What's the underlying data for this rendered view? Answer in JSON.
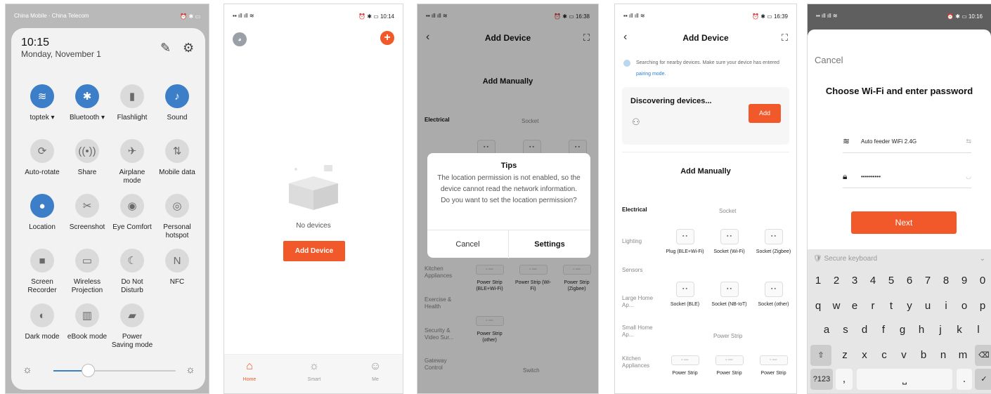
{
  "screen1": {
    "status_left": "China Mobile · China Telecom",
    "status_right": "⏰ ✱ ▭",
    "time": "10:15",
    "date": "Monday, November 1",
    "tiles": [
      {
        "label": "toptek ▾",
        "icon": "wifi-icon",
        "glyph": "≋",
        "on": true
      },
      {
        "label": "Bluetooth ▾",
        "icon": "bluetooth-icon",
        "glyph": "✱",
        "on": true
      },
      {
        "label": "Flashlight",
        "icon": "flashlight-icon",
        "glyph": "▮",
        "on": false
      },
      {
        "label": "Sound",
        "icon": "bell-icon",
        "glyph": "♪",
        "on": true
      },
      {
        "label": "Auto-rotate",
        "icon": "rotate-icon",
        "glyph": "⟳",
        "on": false
      },
      {
        "label": "Share",
        "icon": "share-icon",
        "glyph": "((•))",
        "on": false
      },
      {
        "label": "Airplane mode",
        "icon": "airplane-icon",
        "glyph": "✈",
        "on": false
      },
      {
        "label": "Mobile data",
        "icon": "mobile-data-icon",
        "glyph": "⇅",
        "on": false
      },
      {
        "label": "Location",
        "icon": "location-icon",
        "glyph": "●",
        "on": true
      },
      {
        "label": "Screenshot",
        "icon": "screenshot-icon",
        "glyph": "✂",
        "on": false
      },
      {
        "label": "Eye Comfort",
        "icon": "eye-icon",
        "glyph": "◉",
        "on": false
      },
      {
        "label": "Personal hotspot",
        "icon": "hotspot-icon",
        "glyph": "◎",
        "on": false
      },
      {
        "label": "Screen Recorder",
        "icon": "recorder-icon",
        "glyph": "■",
        "on": false
      },
      {
        "label": "Wireless Projection",
        "icon": "projection-icon",
        "glyph": "▭",
        "on": false
      },
      {
        "label": "Do Not Disturb",
        "icon": "moon-icon",
        "glyph": "☾",
        "on": false
      },
      {
        "label": "NFC",
        "icon": "nfc-icon",
        "glyph": "N",
        "on": false
      },
      {
        "label": "Dark mode",
        "icon": "dark-mode-icon",
        "glyph": "◐",
        "on": false
      },
      {
        "label": "eBook mode",
        "icon": "book-icon",
        "glyph": "▥",
        "on": false
      },
      {
        "label": "Power Saving mode",
        "icon": "battery-icon",
        "glyph": "▰",
        "on": false
      }
    ],
    "brightness": 0.28
  },
  "screen2": {
    "status_left": "▪▪ ıll ıll ≋",
    "status_right": "⏰ ✱ ▭ 10:14",
    "empty_text": "No devices",
    "add_button": "Add Device",
    "tabs": [
      "Home",
      "Smart",
      "Me"
    ]
  },
  "screen3": {
    "status_left": "▪▪ ıll ıll ≋",
    "status_right": "⏰ ✱ ▭ 16:38",
    "title": "Add Device",
    "section": "Add Manually",
    "categories": [
      "Electrical",
      "Kitchen Appliances",
      "Exercise & Health",
      "Security & Video Sur...",
      "Gateway Control"
    ],
    "group_socket": "Socket",
    "group_switch": "Switch",
    "strips": [
      "Power Strip (BLE+Wi-Fi)",
      "Power Strip (Wi-Fi)",
      "Power Strip (Zigbee)",
      "Power Strip (other)"
    ],
    "dialog": {
      "title": "Tips",
      "message": "The location permission is not enabled, so the device cannot read the network information. Do you want to set the location permission?",
      "cancel": "Cancel",
      "settings": "Settings"
    }
  },
  "screen4": {
    "status_left": "▪▪ ıll ıll ≋",
    "status_right": "⏰ ✱ ▭ 16:39",
    "title": "Add Device",
    "search_text": "Searching for nearby devices. Make sure your device has entered",
    "search_link": "pairing mode.",
    "discovering": "Discovering devices...",
    "add_button": "Add",
    "section": "Add Manually",
    "categories": [
      "Electrical",
      "Lighting",
      "Sensors",
      "Large Home Ap...",
      "Small Home Ap...",
      "Kitchen Appliances"
    ],
    "group_socket": "Socket",
    "group_strip": "Power Strip",
    "sockets": [
      "Plug (BLE+Wi-Fi)",
      "Socket (Wi-Fi)",
      "Socket (Zigbee)",
      "Socket (BLE)",
      "Socket (NB-IoT)",
      "Socket (other)"
    ],
    "strips": [
      "Power Strip",
      "Power Strip",
      "Power Strip"
    ]
  },
  "screen5": {
    "status_left": "▪▪ ıll ıll ≋",
    "status_right": "⏰ ✱ ▭ 10:16",
    "cancel": "Cancel",
    "title": "Choose Wi-Fi and enter password",
    "wifi_name": "Auto feeder WiFi 2.4G",
    "password": "••••••••••",
    "next": "Next",
    "keyboard_label": "Secure keyboard",
    "row1": [
      "1",
      "2",
      "3",
      "4",
      "5",
      "6",
      "7",
      "8",
      "9",
      "0"
    ],
    "row2": [
      "q",
      "w",
      "e",
      "r",
      "t",
      "y",
      "u",
      "i",
      "o",
      "p"
    ],
    "row3": [
      "a",
      "s",
      "d",
      "f",
      "g",
      "h",
      "j",
      "k",
      "l"
    ],
    "row4": [
      "z",
      "x",
      "c",
      "v",
      "b",
      "n",
      "m"
    ],
    "mode_key": "?123",
    "comma": ",",
    "period": "."
  }
}
